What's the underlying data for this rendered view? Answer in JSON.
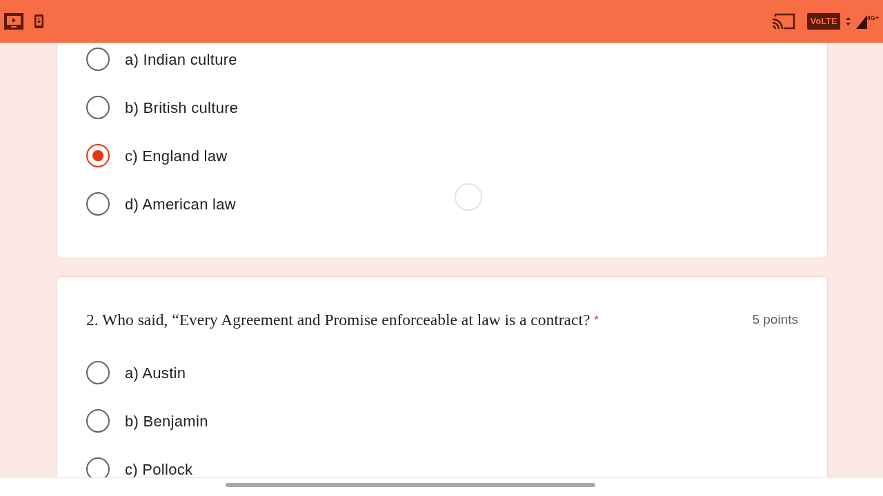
{
  "status_bar": {
    "volte": "VoLTE",
    "network": "4G+"
  },
  "questions": [
    {
      "options": [
        {
          "label": "a) Indian culture",
          "selected": false
        },
        {
          "label": "b) British culture",
          "selected": false
        },
        {
          "label": "c) England law",
          "selected": true
        },
        {
          "label": "d) American law",
          "selected": false
        }
      ]
    },
    {
      "title": "2. Who said, “Every Agreement and Promise enforceable at law is a contract?",
      "required_mark": "*",
      "points": "5 points",
      "options": [
        {
          "label": "a) Austin",
          "selected": false
        },
        {
          "label": "b) Benjamin",
          "selected": false
        },
        {
          "label": "c) Pollock",
          "selected": false
        }
      ]
    }
  ]
}
